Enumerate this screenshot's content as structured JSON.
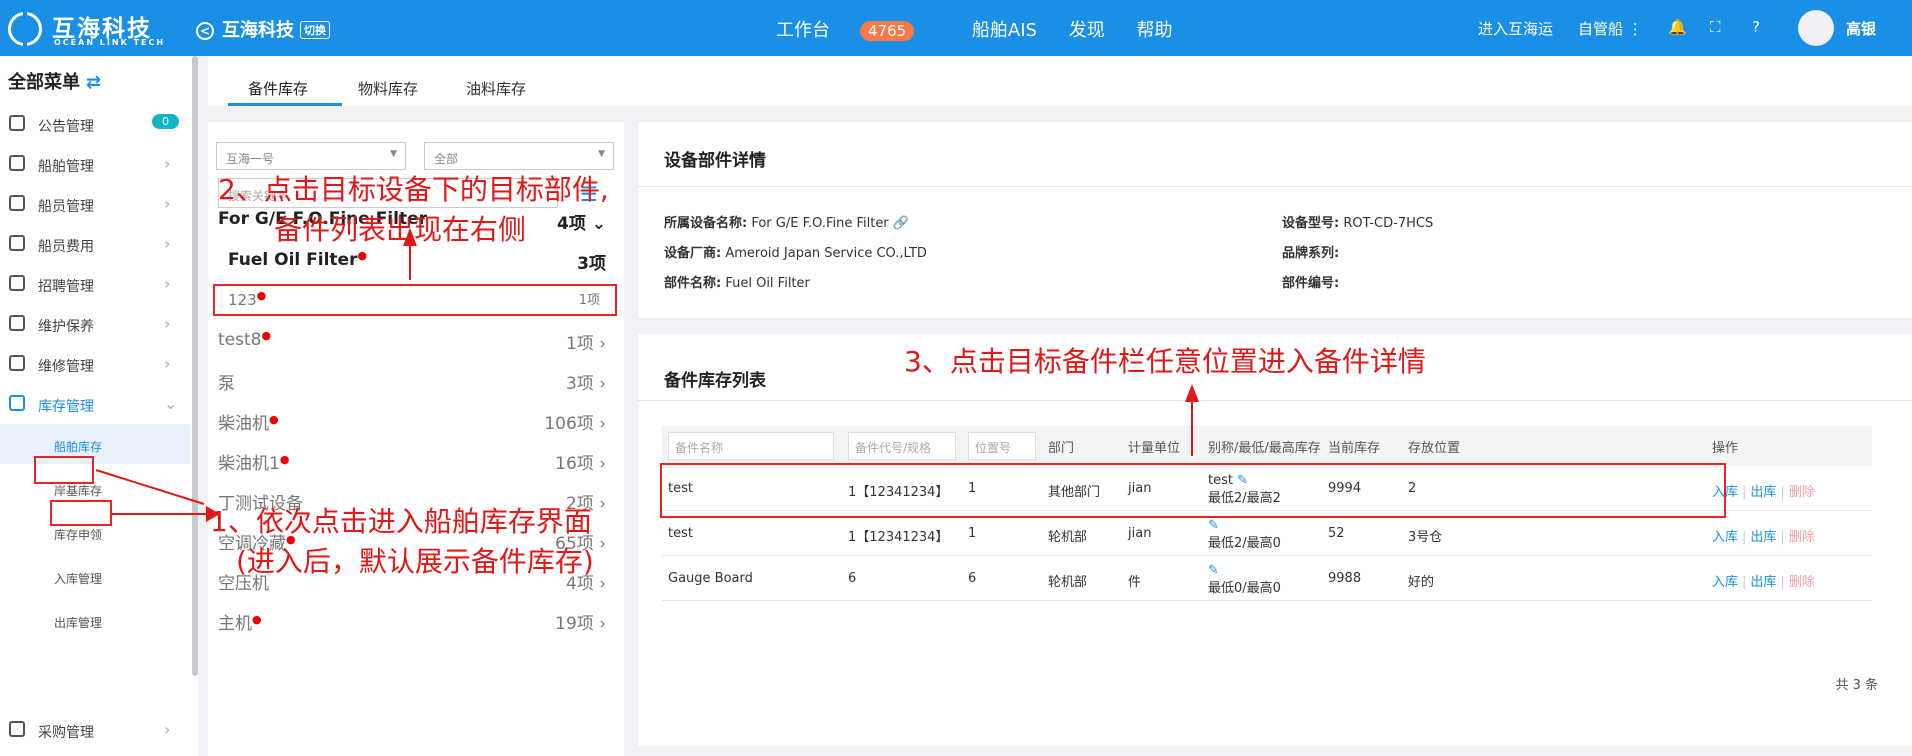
{
  "brand": {
    "cn": "互海科技",
    "en": "OCEAN LINK TECH"
  },
  "header": {
    "company": "互海科技",
    "switch": "切换",
    "nav": [
      "工作台",
      "船舶AIS",
      "发现",
      "帮助"
    ],
    "badge": "4765",
    "enter": "进入互海运",
    "self_managed": "自管船",
    "user": "高银"
  },
  "sidebar": {
    "title": "全部菜单",
    "badge": "0",
    "items": [
      "公告管理",
      "船舶管理",
      "船员管理",
      "船员费用",
      "招聘管理",
      "维护保养",
      "维修管理",
      "库存管理"
    ],
    "sub": [
      "船舶库存",
      "岸基库存",
      "库存申领",
      "入库管理",
      "出库管理"
    ],
    "last": "采购管理"
  },
  "tabs": [
    "备件库存",
    "物料库存",
    "油料库存"
  ],
  "left": {
    "ship": "互海一号",
    "all": "全部",
    "search_ph": "搜索关键字",
    "group": {
      "name": "For G/E F.O.Fine Filter",
      "count": "4项"
    },
    "selected": {
      "name": "Fuel Oil Filter",
      "count": "3项"
    },
    "items": [
      {
        "name": "123",
        "count": "1项"
      },
      {
        "name": "test8",
        "count": "1项"
      },
      {
        "name": "泵",
        "count": "3项"
      },
      {
        "name": "柴油机",
        "count": "106项"
      },
      {
        "name": "柴油机1",
        "count": "16项"
      },
      {
        "name": "丁测试设备",
        "count": "2项"
      },
      {
        "name": "空调冷藏",
        "count": "65项"
      },
      {
        "name": "空压机",
        "count": "4项"
      },
      {
        "name": "主机",
        "count": "19项"
      }
    ]
  },
  "detail": {
    "title": "设备部件详情",
    "equip_label": "所属设备名称:",
    "equip": "For G/E F.O.Fine Filter",
    "maker_label": "设备厂商:",
    "maker": "Ameroid Japan Service CO.,LTD",
    "part_label": "部件名称:",
    "part": "Fuel Oil Filter",
    "model_label": "设备型号:",
    "model": "ROT-CD-7HCS",
    "brand_label": "品牌系列:",
    "no_label": "部件编号:"
  },
  "list": {
    "title": "备件库存列表",
    "filters": [
      "备件名称",
      "备件代号/规格",
      "位置号"
    ],
    "headers": [
      "部门",
      "计量单位",
      "别称/最低/最高库存",
      "当前库存",
      "存放位置",
      "操作"
    ],
    "rows": [
      {
        "name": "test",
        "code": "1【12341234】",
        "pos": "1",
        "dept": "其他部门",
        "unit": "jian",
        "alias": "test",
        "minmax": "最低2/最高2",
        "stock": "9994",
        "loc": "2"
      },
      {
        "name": "test",
        "code": "1【12341234】",
        "pos": "1",
        "dept": "轮机部",
        "unit": "jian",
        "alias": "",
        "minmax": "最低2/最高0",
        "stock": "52",
        "loc": "3号仓"
      },
      {
        "name": "Gauge Board",
        "code": "6",
        "pos": "6",
        "dept": "轮机部",
        "unit": "件",
        "alias": "",
        "minmax": "最低0/最高0",
        "stock": "9988",
        "loc": "好的"
      }
    ],
    "ops": [
      "入库",
      "出库",
      "删除"
    ],
    "total": "共 3 条"
  },
  "annotations": {
    "a1": "1、依次点击进入船舶库存界面",
    "a1b": "(进入后，默认展示备件库存)",
    "a2": "2、点击目标设备下的目标部件,",
    "a2b": "备件列表出现在右侧",
    "a3": "3、点击目标备件栏任意位置进入备件详情"
  }
}
